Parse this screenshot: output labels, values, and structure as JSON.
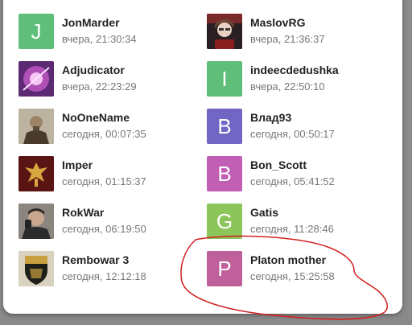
{
  "users": [
    {
      "name": "JonMarder",
      "time": "вчера, 21:30:34",
      "letter": "J",
      "color": "#5fbf7a"
    },
    {
      "name": "MaslovRG",
      "time": "вчера, 21:36:37",
      "letter": "",
      "color": "#2a1f22"
    },
    {
      "name": "Adjudicator",
      "time": "вчера, 22:23:29",
      "letter": "",
      "color": "#b24fb1"
    },
    {
      "name": "indeecdedushka",
      "time": "вчера, 22:50:10",
      "letter": "I",
      "color": "#5fbf7a"
    },
    {
      "name": "NoOneName",
      "time": "сегодня, 00:07:35",
      "letter": "",
      "color": "#7a6a58"
    },
    {
      "name": "Влад93",
      "time": "сегодня, 00:50:17",
      "letter": "B",
      "color": "#7166c4"
    },
    {
      "name": "Imper",
      "time": "сегодня, 01:15:37",
      "letter": "",
      "color": "#5a1414"
    },
    {
      "name": "Bon_Scott",
      "time": "сегодня, 05:41:52",
      "letter": "B",
      "color": "#c05fb4"
    },
    {
      "name": "RokWar",
      "time": "сегодня, 06:19:50",
      "letter": "",
      "color": "#6f6a64"
    },
    {
      "name": "Gatis",
      "time": "сегодня, 11:28:46",
      "letter": "G",
      "color": "#8cc55a"
    },
    {
      "name": "Rembowar 3",
      "time": "сегодня, 12:12:18",
      "letter": "",
      "color": "#3a3a2a"
    },
    {
      "name": "Platon mother",
      "time": "сегодня, 15:25:58",
      "letter": "P",
      "color": "#c0609a"
    }
  ]
}
